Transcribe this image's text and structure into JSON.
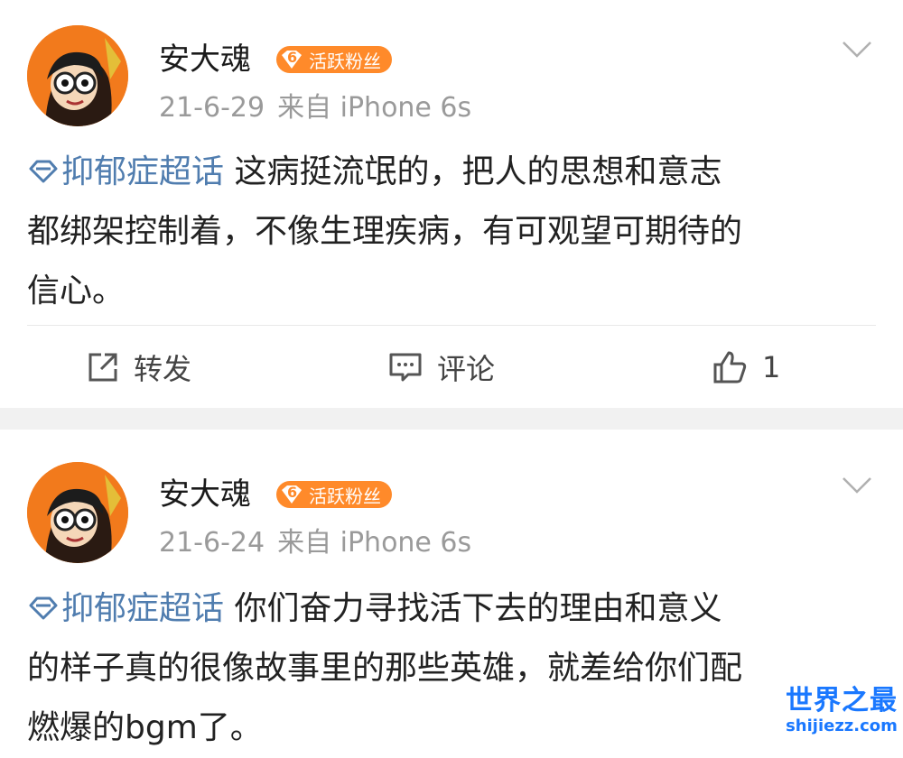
{
  "posts": [
    {
      "username": "安大魂",
      "badge_level": "6",
      "badge_label": "活跃粉丝",
      "date": "21-6-29",
      "source": "来自 iPhone 6s",
      "topic": "抑郁症超话",
      "lines": [
        "这病挺流氓的，把人的思想和意志",
        "都绑架控制着，不像生理疾病，有可观望可期待的",
        "信心。"
      ],
      "actions": {
        "repost": "转发",
        "comment": "评论",
        "likes": "1"
      }
    },
    {
      "username": "安大魂",
      "badge_level": "6",
      "badge_label": "活跃粉丝",
      "date": "21-6-24",
      "source": "来自 iPhone 6s",
      "topic": "抑郁症超话",
      "lines": [
        "你们奋力寻找活下去的理由和意义",
        "的样子真的很像故事里的那些英雄，就差给你们配",
        "燃爆的bgm了。"
      ]
    }
  ],
  "watermark": {
    "main": "世界之最",
    "sub": "shijiezz.com"
  },
  "colors": {
    "topic": "#507daf",
    "badge": "#ff8a2a",
    "meta": "#9a9a9a",
    "separator": "#f1f1f1",
    "watermark": "#1a78ff"
  },
  "icons": {
    "avatar": "cartoon-avatar",
    "menu": "chevron-down-icon",
    "topic": "diamond-icon",
    "repost": "share-icon",
    "comment": "comment-icon",
    "like": "thumbs-up-icon"
  }
}
